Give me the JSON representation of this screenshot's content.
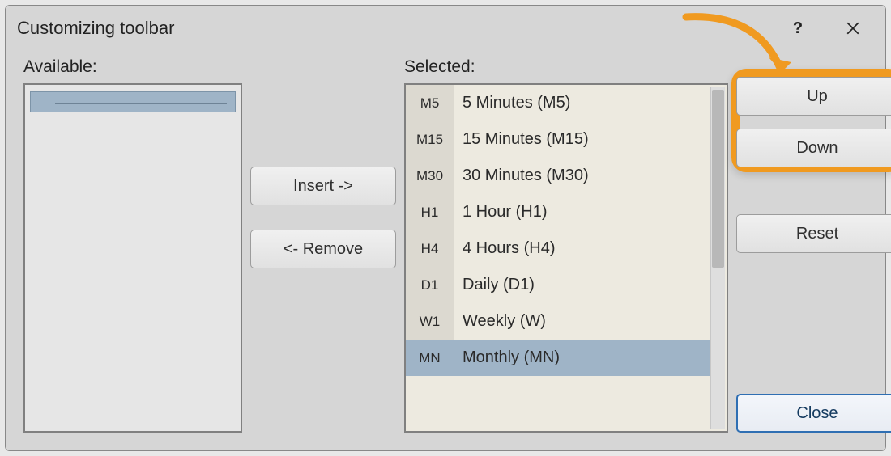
{
  "titlebar": {
    "title": "Customizing toolbar"
  },
  "columns": {
    "available": {
      "label": "Available:"
    },
    "selected": {
      "label": "Selected:",
      "items": [
        {
          "code": "M5",
          "label": "5 Minutes (M5)"
        },
        {
          "code": "M15",
          "label": "15 Minutes (M15)"
        },
        {
          "code": "M30",
          "label": "30 Minutes (M30)"
        },
        {
          "code": "H1",
          "label": "1 Hour (H1)"
        },
        {
          "code": "H4",
          "label": "4 Hours (H4)"
        },
        {
          "code": "D1",
          "label": "Daily (D1)"
        },
        {
          "code": "W1",
          "label": "Weekly (W)"
        },
        {
          "code": "MN",
          "label": "Monthly (MN)"
        }
      ],
      "selected_index": 7
    }
  },
  "buttons": {
    "insert": "Insert ->",
    "remove": "<- Remove",
    "up": "Up",
    "down": "Down",
    "reset": "Reset",
    "close": "Close"
  },
  "annotations": {
    "highlight": "up-down-reorder-buttons",
    "highlight_color": "#f09a20"
  }
}
